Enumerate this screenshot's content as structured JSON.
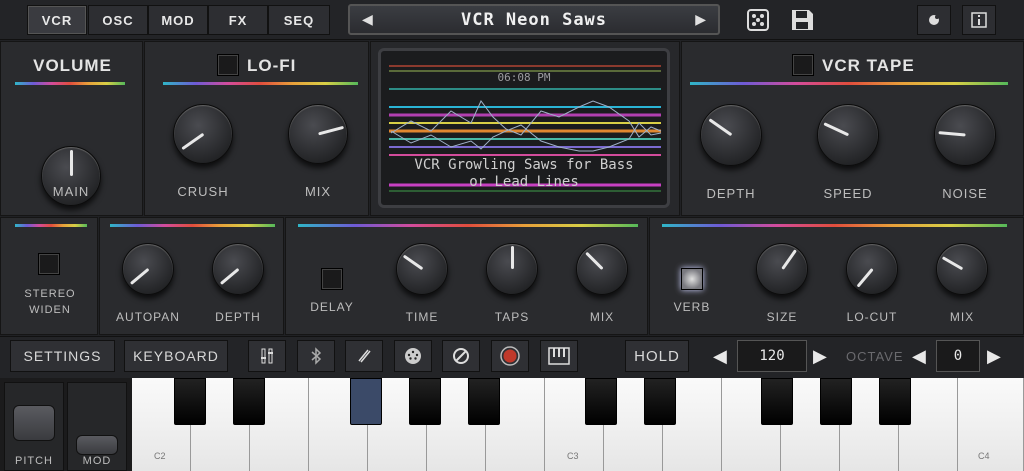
{
  "tabs": [
    "VCR",
    "OSC",
    "MOD",
    "FX",
    "SEQ"
  ],
  "preset_name": "VCR Neon Saws",
  "volume": {
    "title": "VOLUME",
    "knob": "MAIN"
  },
  "lofi": {
    "title": "LO-FI",
    "knobs": [
      "CRUSH",
      "MIX"
    ]
  },
  "screen": {
    "time": "06:08 PM",
    "line1": "VCR Growling Saws for Bass",
    "line2": "or Lead Lines"
  },
  "vcrtape": {
    "title": "VCR TAPE",
    "knobs": [
      "DEPTH",
      "SPEED",
      "NOISE"
    ]
  },
  "stereo": {
    "line1": "STEREO",
    "line2": "WIDEN"
  },
  "autopan": {
    "knobs": [
      "AUTOPAN",
      "DEPTH"
    ]
  },
  "delay": {
    "toggle": "DELAY",
    "knobs": [
      "TIME",
      "TAPS",
      "MIX"
    ]
  },
  "verb": {
    "toggle": "VERB",
    "knobs": [
      "SIZE",
      "LO-CUT",
      "MIX"
    ]
  },
  "bottom": {
    "settings": "SETTINGS",
    "keyboard": "KEYBOARD",
    "hold": "HOLD",
    "tempo": "120",
    "octave_label": "OCTAVE",
    "octave": "0"
  },
  "wheels": {
    "pitch": "PITCH",
    "mod": "MOD"
  },
  "keys": {
    "c2": "C2",
    "c3": "C3",
    "c4": "C4"
  },
  "icons": [
    "dice-icon",
    "save-icon",
    "record-top-icon",
    "info-icon",
    "mixer-icon",
    "bluetooth-icon",
    "pen-icon",
    "midi-icon",
    "stop-icon",
    "record-icon",
    "piano-icon"
  ]
}
